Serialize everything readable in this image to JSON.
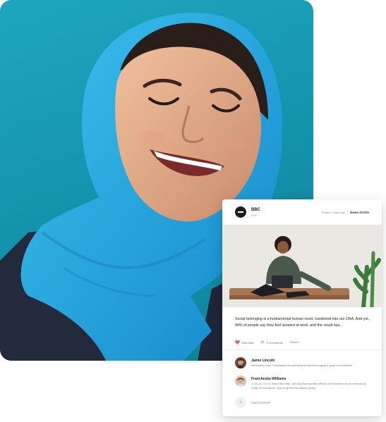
{
  "article": {
    "source_name": "BBC",
    "source_sub": "8.5K",
    "posted": "Posted 2 days ago",
    "type": "News Article",
    "description": "Social belonging is a fundamental human need, hardwired into our DNA. And yet, 40% of people say they feel isolated at work, and the result has...",
    "likes": "536 Likes",
    "comments": "2 Comments",
    "share": "Share +"
  },
  "comments": [
    {
      "name": "Jamie Lincoln",
      "mention": "",
      "text": "Interesting read. Companies should keep in mind belonging is good for business."
    },
    {
      "name": "Francheska Williams",
      "mention": "@Jamie Lincoln",
      "text": "More than that, the idea that harmful effects of exclusion can be reversed is really no excuse for orgs to ignore the isssue jointly."
    }
  ],
  "add_comment": "Add Comment",
  "colors": {
    "hero_bg": "#1ea6bf",
    "scarf": "#23a6e0",
    "heart": "#e05a7a",
    "share": "#3a7be0"
  },
  "icons": {
    "like": "heart-icon",
    "comment": "comment-bubble-icon",
    "add": "plus-icon"
  }
}
